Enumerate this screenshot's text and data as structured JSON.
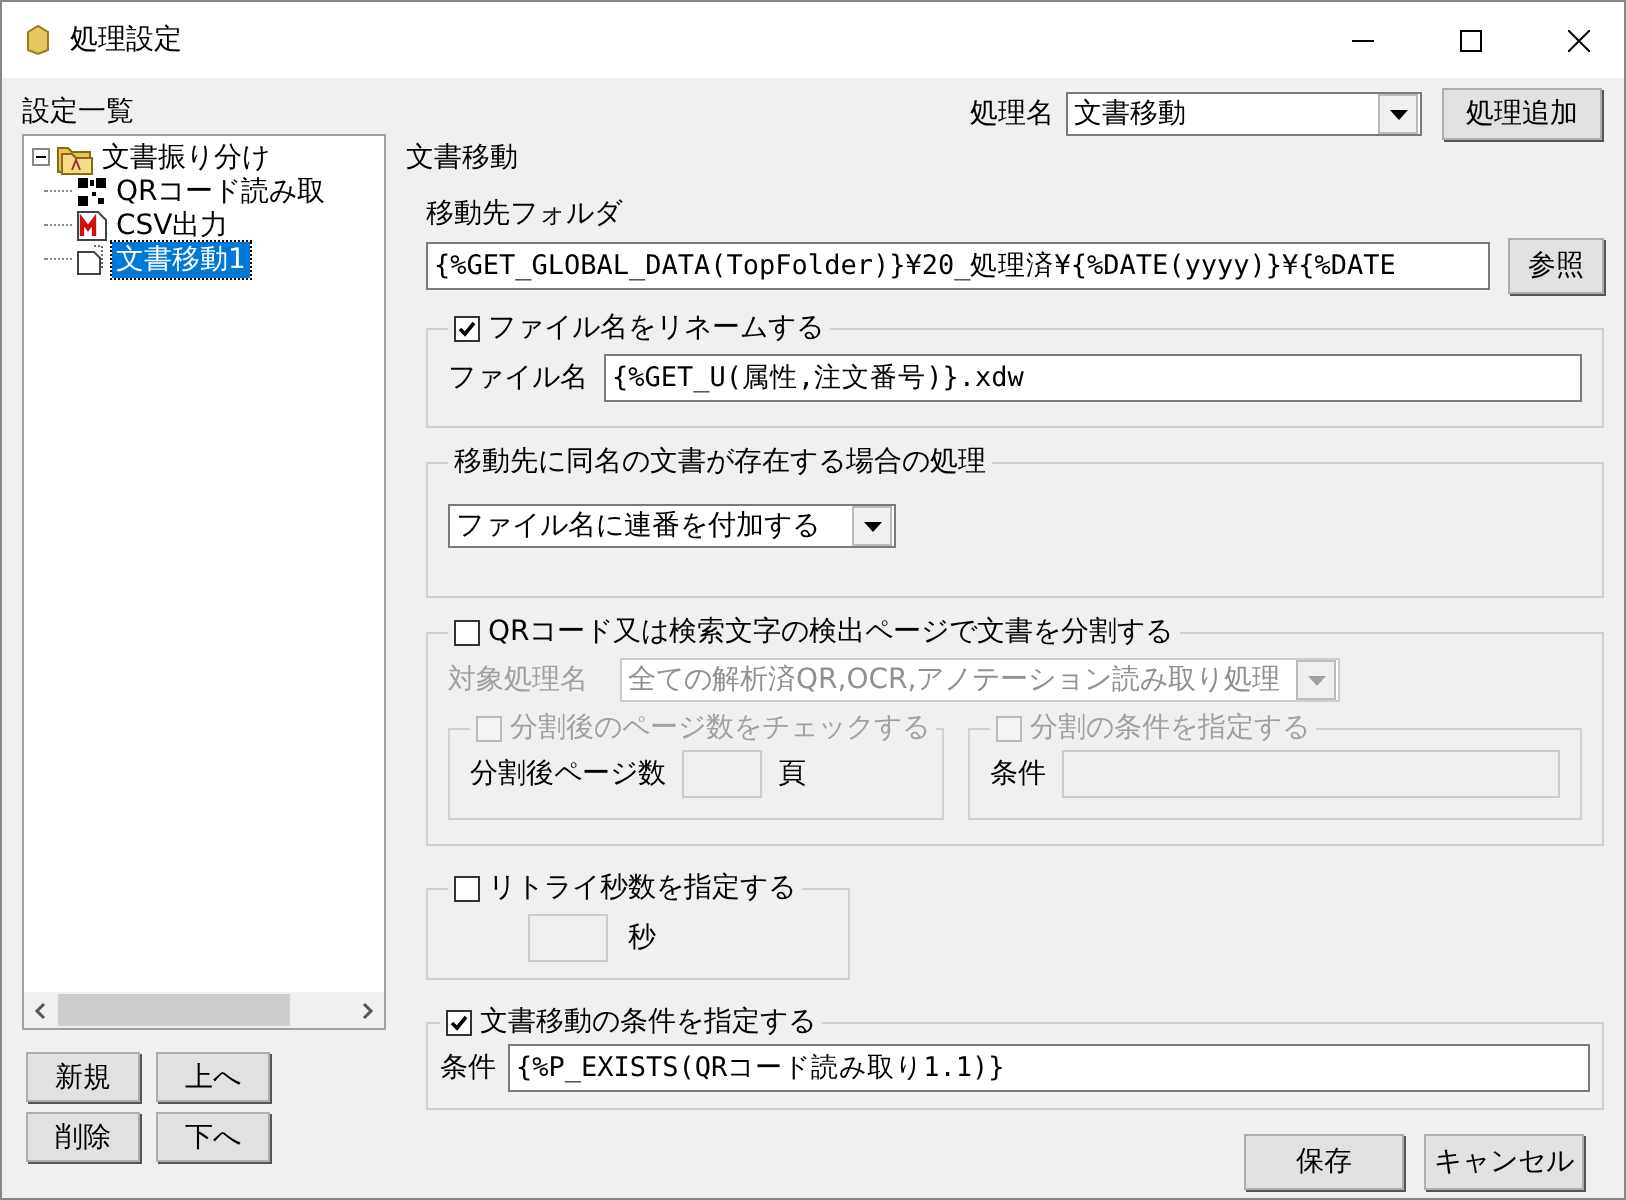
{
  "window": {
    "title": "処理設定"
  },
  "sidebar": {
    "label": "設定一覧",
    "tree": [
      {
        "label": "文書振り分け",
        "kind": "folder",
        "expanded": true,
        "selected": false,
        "children": [
          {
            "label": "QRコード読み取",
            "kind": "qr",
            "selected": false
          },
          {
            "label": "CSV出力",
            "kind": "csv",
            "selected": false
          },
          {
            "label": "文書移動1",
            "kind": "move",
            "selected": true
          }
        ]
      }
    ],
    "buttons": [
      [
        "新規",
        "上へ"
      ],
      [
        "削除",
        "下へ"
      ]
    ]
  },
  "process_name": {
    "label": "処理名",
    "value": "文書移動",
    "add_button": "処理追加"
  },
  "section_title": "文書移動",
  "destination": {
    "label": "移動先フォルダ",
    "value": "{%GET_GLOBAL_DATA(TopFolder)}¥20_処理済¥{%DATE(yyyy)}¥{%DATE",
    "browse_button": "参照"
  },
  "rename": {
    "label": "ファイル名をリネームする",
    "checked": true,
    "field_label": "ファイル名",
    "value": "{%GET_U(属性,注文番号)}.xdw"
  },
  "duplicate": {
    "title": "移動先に同名の文書が存在する場合の処理",
    "value": "ファイル名に連番を付加する"
  },
  "split": {
    "label": "QRコード又は検索文字の検出ページで文書を分割する",
    "checked": false,
    "target_label": "対象処理名",
    "target_value": "全ての解析済QR,OCR,アノテーション読み取り処理",
    "page_check": {
      "label": "分割後のページ数をチェックする",
      "checked": false,
      "field_label": "分割後ページ数",
      "unit": "頁"
    },
    "condition": {
      "label": "分割の条件を指定する",
      "checked": false,
      "field_label": "条件"
    }
  },
  "retry": {
    "label": "リトライ秒数を指定する",
    "checked": false,
    "unit": "秒"
  },
  "move_condition": {
    "label": "文書移動の条件を指定する",
    "checked": true,
    "field_label": "条件",
    "value": "{%P_EXISTS(QRコード読み取り1.1)}"
  },
  "buttons": [
    "保存",
    "キャンセル"
  ]
}
